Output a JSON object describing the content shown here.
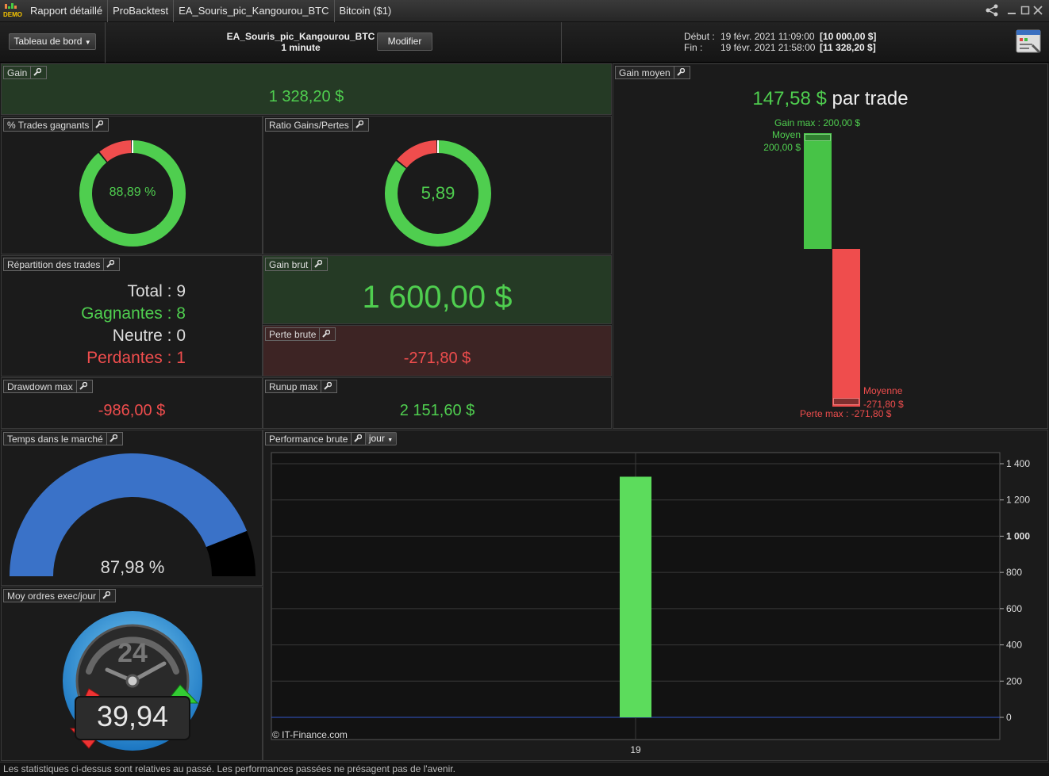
{
  "tabs": [
    "Rapport détaillé",
    "ProBacktest",
    "EA_Souris_pic_Kangourou_BTC",
    "Bitcoin ($1)"
  ],
  "logo_text": "DEMO",
  "toolbar": {
    "dashboard_label": "Tableau de bord",
    "strategy_name": "EA_Souris_pic_Kangourou_BTC",
    "timeframe": "1 minute",
    "modify_label": "Modifier",
    "start_label": "Début :",
    "start_date": "19 févr. 2021 11:09:00",
    "start_value": "[10 000,00 $]",
    "end_label": "Fin :",
    "end_date": "19 févr. 2021 21:58:00",
    "end_value": "[11 328,20 $]"
  },
  "gain": {
    "label": "Gain",
    "value": "1 328,20 $"
  },
  "win_pct": {
    "label": "% Trades gagnants",
    "value": "88,89 %",
    "fraction": 0.8889
  },
  "ratio": {
    "label": "Ratio Gains/Pertes",
    "value": "5,89",
    "fraction": 0.8549
  },
  "repartition": {
    "label": "Répartition des trades",
    "total": "Total : 9",
    "winners": "Gagnantes : 8",
    "neutral": "Neutre : 0",
    "losers": "Perdantes : 1"
  },
  "gross_gain": {
    "label": "Gain brut",
    "value": "1 600,00 $"
  },
  "gross_loss": {
    "label": "Perte brute",
    "value": "-271,80 $"
  },
  "drawdown": {
    "label": "Drawdown max",
    "value": "-986,00 $"
  },
  "runup": {
    "label": "Runup max",
    "value": "2 151,60 $"
  },
  "avg_gain": {
    "label": "Gain moyen",
    "value": "147,58 $",
    "suffix": "par trade",
    "gain_max": "Gain max : 200,00 $",
    "avg_win_label": "Moyen",
    "avg_win_value": "200,00 $",
    "avg_loss_label": "Moyenne",
    "avg_loss_value": "-271,80 $",
    "loss_max": "Perte max : -271,80 $"
  },
  "time_in_market": {
    "label": "Temps dans le marché",
    "value": "87,98 %",
    "fraction": 0.8798
  },
  "orders_per_day": {
    "label": "Moy ordres exec/jour",
    "clock_text": "24",
    "value": "39,94"
  },
  "performance": {
    "label": "Performance brute",
    "period": "jour",
    "watermark": "© IT-Finance.com"
  },
  "chart_data": {
    "type": "bar",
    "categories": [
      "19"
    ],
    "values": [
      1328.2
    ],
    "ylim": [
      0,
      1450
    ],
    "yticks": [
      0,
      200,
      400,
      600,
      800,
      1000,
      1200,
      1400
    ],
    "ytick_labels": [
      "0",
      "200",
      "400",
      "600",
      "800",
      "1 000",
      "1 200",
      "1 400"
    ],
    "grid": true,
    "color": "#5cdc5c"
  },
  "footer": "Les statistiques ci-dessus sont relatives au passé. Les performances passées ne présagent pas de l'avenir.",
  "colors": {
    "green": "#4fce4f",
    "red": "#ef4d4d",
    "blue": "#3a72c8"
  }
}
